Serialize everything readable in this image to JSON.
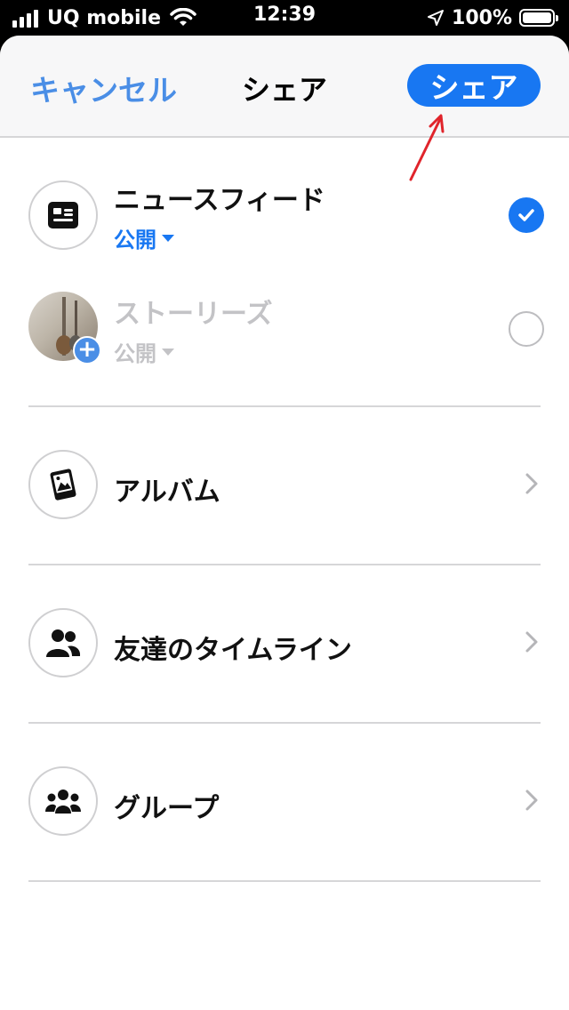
{
  "status_bar": {
    "carrier": "UQ mobile",
    "time": "12:39",
    "battery": "100%"
  },
  "nav": {
    "cancel_label": "キャンセル",
    "title": "シェア",
    "share_label": "シェア"
  },
  "destinations": {
    "news_feed": {
      "title": "ニュースフィード",
      "privacy": "公開",
      "selected": true
    },
    "stories": {
      "title": "ストーリーズ",
      "privacy": "公開",
      "selected": false
    },
    "album": {
      "title": "アルバム"
    },
    "friend_timeline": {
      "title": "友達のタイムライン"
    },
    "group": {
      "title": "グループ"
    }
  },
  "colors": {
    "accent": "#1877f2",
    "cancel": "#4a8ee6",
    "annotation_arrow": "#e0242b"
  },
  "icons": {
    "news_feed": "newspaper-icon",
    "stories": "story-photo-icon",
    "album": "album-icon",
    "friend_timeline": "friends-icon",
    "group": "group-icon"
  }
}
